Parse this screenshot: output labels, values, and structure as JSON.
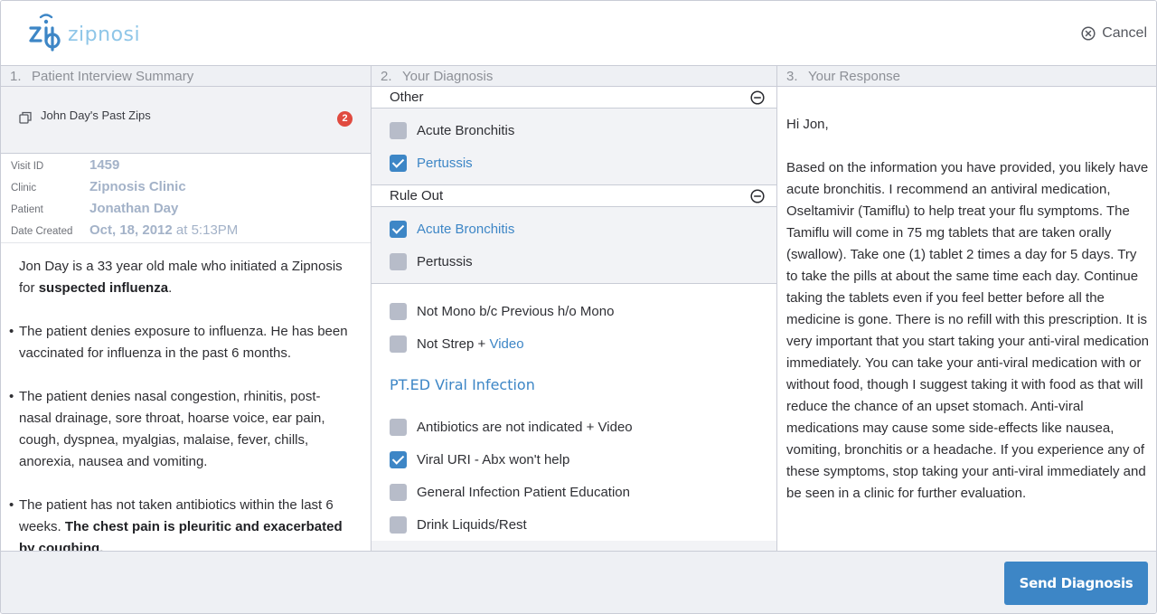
{
  "brand": {
    "logo_text": "zipnosis",
    "accent": "#3d86c6"
  },
  "header": {
    "cancel_label": "Cancel",
    "cancel_icon": "close-circle-icon"
  },
  "columns": {
    "summary": {
      "num": "1.",
      "title": "Patient Interview Summary"
    },
    "diagnosis": {
      "num": "2.",
      "title": "Your Diagnosis"
    },
    "response": {
      "num": "3.",
      "title": "Your Response"
    }
  },
  "past_zips": {
    "label": "John Day's Past Zips",
    "count": "2",
    "icon": "copy-icon"
  },
  "visit": {
    "visit_id_label": "Visit ID",
    "visit_id": "1459",
    "clinic_label": "Clinic",
    "clinic": "Zipnosis Clinic",
    "patient_label": "Patient",
    "patient": "Jonathan Day",
    "date_label": "Date Created",
    "date": "Oct, 18, 2012",
    "at": "at",
    "time": "5:13PM"
  },
  "summary": {
    "intro": "Jon Day is a 33 year old male who initiated a Zipnosis for ",
    "intro_bold": "suspected influenza",
    "intro_end": ".",
    "bullet1": "The patient denies exposure to influenza. He has been vaccinated for influenza in the past 6 months.",
    "bullet2": "The patient denies nasal congestion, rhinitis, post-nasal drainage, sore throat, hoarse voice, ear pain, cough, dyspnea, myalgias, malaise, fever, chills, anorexia, nausea and vomiting.",
    "bullet3": "The patient has not taken antibiotics within the last 6 weeks. ",
    "bullet3_bold": "The chest pain is pleuritic and exacerbated by coughing."
  },
  "diagnosis": {
    "other": {
      "title": "Other",
      "options": [
        {
          "label": "Acute Bronchitis",
          "checked": false
        },
        {
          "label": "Pertussis",
          "checked": true
        }
      ]
    },
    "rule_out": {
      "title": "Rule Out",
      "options": [
        {
          "label": "Acute Bronchitis",
          "checked": true
        },
        {
          "label": "Pertussis",
          "checked": false
        }
      ]
    },
    "extra": [
      {
        "label": "Not Mono b/c Previous h/o Mono",
        "checked": false
      },
      {
        "label": "Not Strep + ",
        "link": "Video",
        "checked": false
      }
    ],
    "pt_ed_title": "PT.ED Viral Infection",
    "pt_ed": [
      {
        "label": "Antibiotics are not indicated + Video",
        "checked": false
      },
      {
        "label": "Viral URI - Abx won't help",
        "checked": true
      },
      {
        "label": "General Infection Patient Education",
        "checked": false
      },
      {
        "label": "Drink Liquids/Rest",
        "checked": false
      }
    ]
  },
  "response": {
    "greeting": "Hi Jon,",
    "body": "Based on the information you have provided, you likely have acute bronchitis. I recommend an antiviral medication, Oseltamivir (Tamiflu) to help treat your flu symptoms. The Tamiflu will come in 75 mg tablets that are taken orally (swallow). Take one (1) tablet 2 times a day for 5 days. Try to take the pills at about the same time each day. Continue taking the tablets even if you feel better before all the medicine is gone. There is no refill with this prescription. It is very important that you start taking your anti-viral medication immediately. You can take your anti-viral medication with or without food, though I suggest taking it with food as that will reduce the chance of an upset stomach. Anti-viral medications may cause some side-effects like nausea, vomiting, bronchitis or a headache. If you experience any of these symptoms, stop taking your anti-viral immediately and be seen in a clinic for further evaluation."
  },
  "footer": {
    "send_label": "Send Diagnosis"
  }
}
